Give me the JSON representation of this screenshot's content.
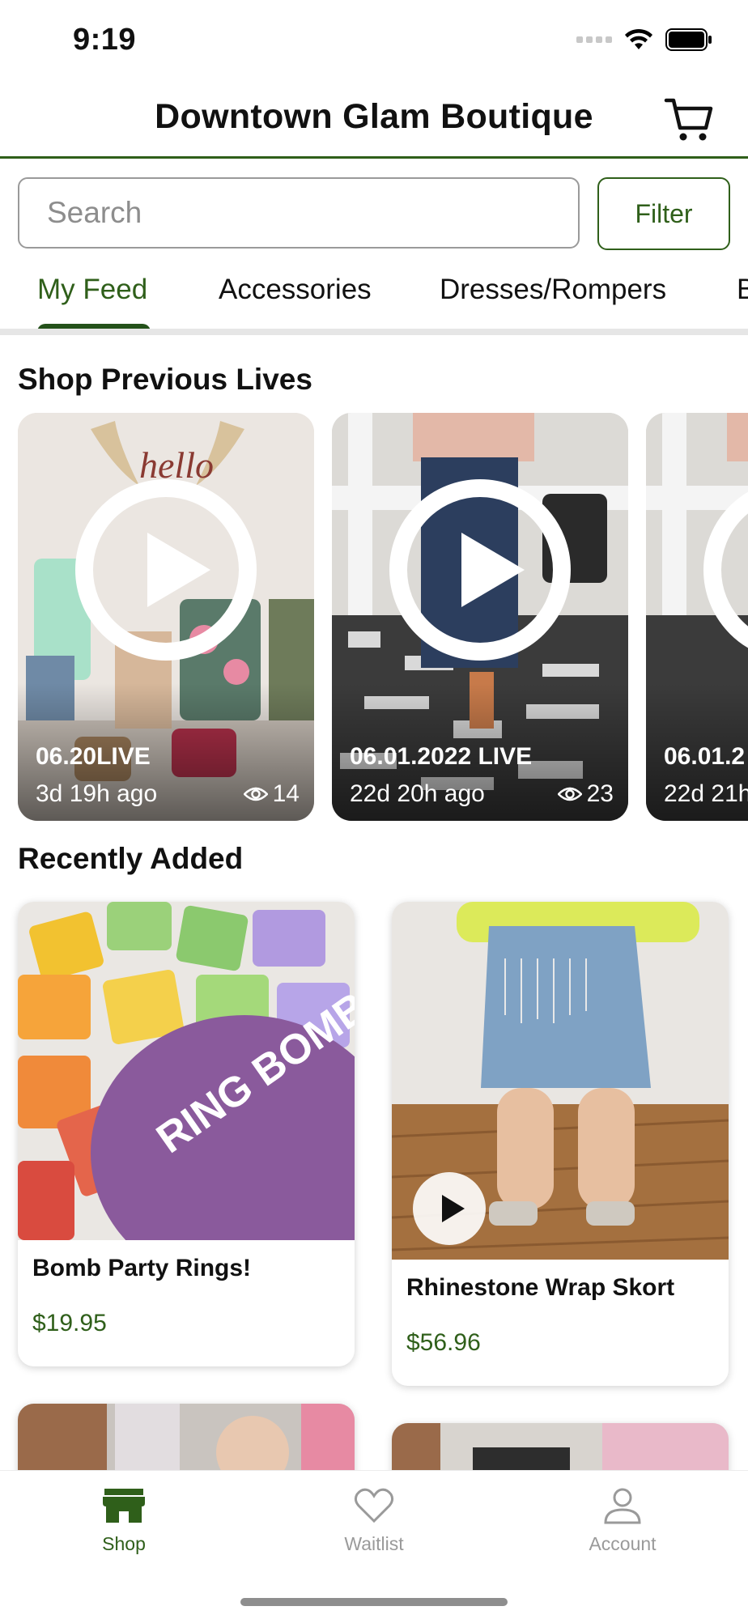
{
  "status_bar": {
    "time": "9:19"
  },
  "header": {
    "title": "Downtown Glam Boutique",
    "cart_icon": "shopping-cart-icon"
  },
  "search": {
    "placeholder": "Search",
    "value": ""
  },
  "filter": {
    "label": "Filter"
  },
  "tabs": [
    {
      "label": "My Feed",
      "active": true
    },
    {
      "label": "Accessories",
      "active": false
    },
    {
      "label": "Dresses/Rompers",
      "active": false
    },
    {
      "label": "B",
      "active": false
    }
  ],
  "lives": {
    "title": "Shop Previous Lives",
    "items": [
      {
        "title": "06.20LIVE",
        "ago": "3d 19h ago",
        "views": "14"
      },
      {
        "title": "06.01.2022 LIVE",
        "ago": "22d 20h ago",
        "views": "23"
      },
      {
        "title": "06.01.2",
        "ago": "22d 21h",
        "views": ""
      }
    ]
  },
  "recent": {
    "title": "Recently Added",
    "products": [
      {
        "name": "Bomb Party Rings!",
        "price": "$19.95",
        "image_text": "RING BOMB PARTY"
      },
      {
        "name": "Rhinestone Wrap Skort",
        "price": "$56.96"
      }
    ]
  },
  "bottom_nav": [
    {
      "label": "Shop",
      "icon": "storefront-icon",
      "active": true
    },
    {
      "label": "Waitlist",
      "icon": "heart-icon",
      "active": false
    },
    {
      "label": "Account",
      "icon": "person-icon",
      "active": false
    }
  ],
  "colors": {
    "brand_green": "#2f5f1a",
    "tab_indicator": "#24511a",
    "price_green": "#2f5f1a"
  }
}
